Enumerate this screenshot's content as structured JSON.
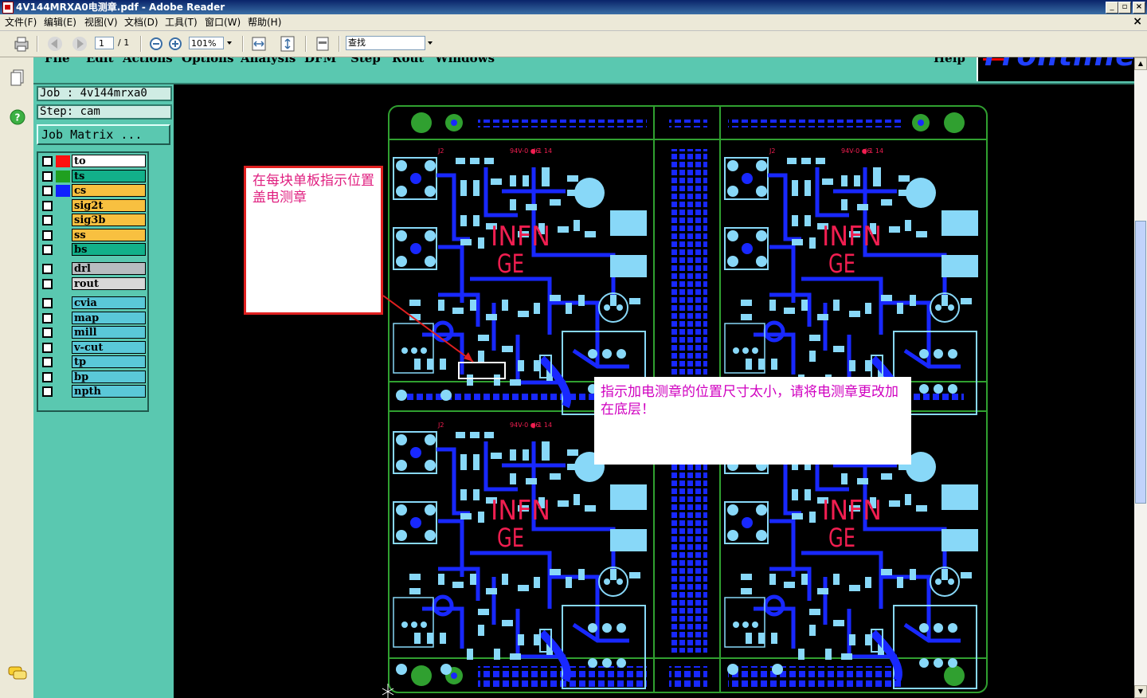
{
  "window": {
    "title": "4V144MRXA0电测章.pdf - Adobe Reader",
    "buttons": [
      "_",
      "▫",
      "×"
    ]
  },
  "menubar": {
    "items": [
      "文件(F)",
      "编辑(E)",
      "视图(V)",
      "文档(D)",
      "工具(T)",
      "窗口(W)",
      "帮助(H)"
    ],
    "close": "×"
  },
  "toolbar": {
    "page_current": "1",
    "page_total": "/ 1",
    "zoom": "101%",
    "search_placeholder": "查找"
  },
  "genesis": {
    "menu": [
      "File",
      "Edit",
      "Actions",
      "Options",
      "Analysis",
      "DFM",
      "Step",
      "Rout",
      "Windows",
      "Help"
    ],
    "logo": "Frontline",
    "job_label": "Job : 4v144mrxa0",
    "step_label": "Step: cam",
    "job_matrix": "Job Matrix ...",
    "layers": [
      {
        "name": "to",
        "color": "#ff1010",
        "bg": "#ffffff"
      },
      {
        "name": "ts",
        "color": "#20a020",
        "bg": "#12b08a"
      },
      {
        "name": "cs",
        "color": "#1020ff",
        "bg": "#f8c040"
      },
      {
        "name": "sig2t",
        "color": "",
        "bg": "#f8c040"
      },
      {
        "name": "sig3b",
        "color": "",
        "bg": "#f8c040"
      },
      {
        "name": "ss",
        "color": "",
        "bg": "#f8c040"
      },
      {
        "name": "bs",
        "color": "",
        "bg": "#12b08a"
      },
      {
        "name": "drl",
        "color": "",
        "bg": "#b8bcc0"
      },
      {
        "name": "rout",
        "color": "",
        "bg": "#d8d8d8"
      },
      {
        "name": "cvia",
        "color": "",
        "bg": "#5ac8d8"
      },
      {
        "name": "map",
        "color": "",
        "bg": "#5ac8d8"
      },
      {
        "name": "mill",
        "color": "",
        "bg": "#5ac8d8"
      },
      {
        "name": "v-cut",
        "color": "",
        "bg": "#5ac8d8"
      },
      {
        "name": "tp",
        "color": "",
        "bg": "#5ac8d8"
      },
      {
        "name": "bp",
        "color": "",
        "bg": "#5ac8d8"
      },
      {
        "name": "npth",
        "color": "",
        "bg": "#5ac8d8"
      }
    ]
  },
  "pcb": {
    "board_text": "INFN",
    "board_text2": "GE"
  },
  "annotations": {
    "note1": "在每块单板指示位置盖电测章",
    "note2": "指示加电测章的位置尺寸太小，请将电测章更改加在底层！"
  },
  "colors": {
    "pcb_green": "#30a030",
    "pcb_blue": "#1828ff",
    "pcb_cyan": "#88d8f8",
    "pcb_red": "#f01e50"
  }
}
